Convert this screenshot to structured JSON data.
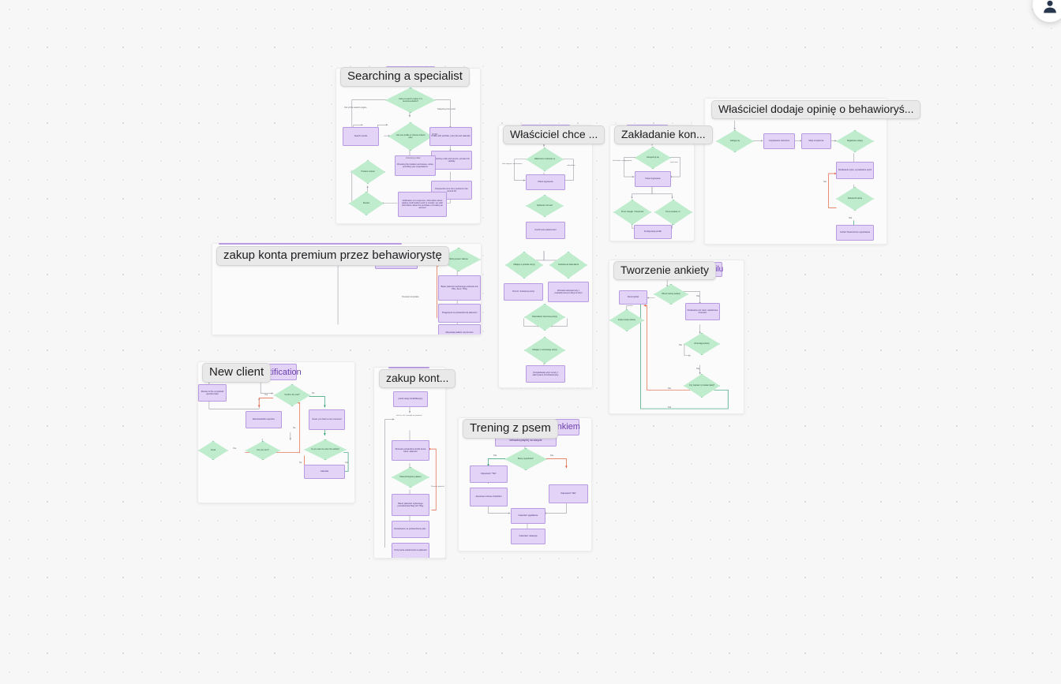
{
  "app": {
    "canvas_background": "#f7f7f8",
    "node_fill_purple": "#e3d4f7",
    "node_stroke_purple": "#b79ae0",
    "node_fill_green": "#bfeccd",
    "node_stroke_green": "#79c894",
    "edge_yes_color": "#2f9e6e",
    "edge_no_color": "#e0603f",
    "edge_default_color": "#9a9aa4"
  },
  "toolbar": {
    "avatar_icon": "user-avatar-icon"
  },
  "frames": [
    {
      "id": "searching-a-specialist",
      "title": "Searching a specialist",
      "banner_label": "",
      "nodes": [
        {
          "type": "diamond",
          "text": "Using a search engine or a recommendation?"
        },
        {
          "type": "rect",
          "text": "Search results"
        },
        {
          "type": "diamond",
          "text": "Just one profile or choose criteria plan"
        },
        {
          "type": "rect",
          "text": "Profile with portfolio, price list and calendar"
        },
        {
          "type": "rect",
          "text": "Selecting a title and service, private rich visibility"
        },
        {
          "type": "rect",
          "text": "Choosing the location and issues, notes, providing your expectations"
        },
        {
          "type": "rect",
          "text": "Perspective time form pushed to the remind list"
        },
        {
          "type": "rect",
          "text": "Notification of a response, information about waiting confirmation push or contact, we wish information about the purchase of creating an account"
        },
        {
          "type": "diamond",
          "text": "Product contact"
        },
        {
          "type": "diamond",
          "text": "Review"
        }
      ],
      "edge_labels": [
        "Out of the search engine",
        "Selecting from a list",
        "Profile",
        "choosing a date"
      ]
    },
    {
      "id": "zakup-konta-premium",
      "title": "zakup konta premium przez behawiorystę",
      "banner_label": "",
      "nodes": [
        {
          "type": "rect",
          "text": "Zimna i potwierdzeni linkiej konta baza i płatność"
        },
        {
          "type": "diamond",
          "text": "Mózg system zakupu"
        },
        {
          "type": "rect",
          "text": "Baner płatności wybranego podmiotu lub PSU, ALG i TPay"
        },
        {
          "type": "rect",
          "text": "Ściągnięcia na potwierdzenia płatności"
        },
        {
          "type": "rect",
          "text": "Aktywacja pakietu na premium"
        }
      ],
      "edge_labels": [
        "Ponowić wszystkie"
      ]
    },
    {
      "id": "wlasciciel-chce",
      "title": "Właściciel chce ...",
      "banner_label": "",
      "nodes": [
        {
          "type": "diamond",
          "text": "Właściciel w ankiecie są"
        },
        {
          "type": "rect",
          "text": "Płatni logowania"
        },
        {
          "type": "diamond",
          "text": "Wybieram formach"
        },
        {
          "type": "rect",
          "text": "Konfirmowi wiadomości"
        },
        {
          "type": "diamond",
          "text": "Klikając w portalie wizyty"
        },
        {
          "type": "diamond",
          "text": "Gotówka do kalendarza"
        },
        {
          "type": "rect",
          "text": "Termin i funkcjonuj wizyt"
        },
        {
          "type": "rect",
          "text": "Wniosek tekstowe listy z powiadomionymi danymi wizyt"
        },
        {
          "type": "diamond",
          "text": "Odwrotkami tworzonej wizyty"
        },
        {
          "type": "diamond",
          "text": "Klikając w rezerwację wizyty"
        },
        {
          "type": "rect",
          "text": "Oczujki/kwały wizyt w listy z zakrzywami od behawiorysty"
        }
      ],
      "edge_labels": [
        "Jako ukrywa i zachowanie",
        "nakrytkiem"
      ]
    },
    {
      "id": "zakladanie-konta",
      "title": "Zakładanie kon...",
      "banner_label": "",
      "nodes": [
        {
          "type": "diamond",
          "text": "Zarejestruj się"
        },
        {
          "type": "rect",
          "text": "Panel logowania"
        },
        {
          "type": "diamond",
          "text": "Przez Google / Facebook"
        },
        {
          "type": "diamond",
          "text": "Przez podanie nr..."
        },
        {
          "type": "rect",
          "text": "Konfiguracja profilu"
        }
      ],
      "edge_labels": [
        "Jeśli konta i zalogowanie",
        "zwrócenie"
      ]
    },
    {
      "id": "wlasciciel-dodaje-opinie",
      "title": "Właściciel dodaje opinię o behawioryś...",
      "banner_label": "",
      "nodes": [
        {
          "type": "diamond",
          "text": "Zaloguj się"
        },
        {
          "type": "rect",
          "text": "Uzyskiwanie ostrzeżeń"
        },
        {
          "type": "rect",
          "text": "Moje urządzenie"
        },
        {
          "type": "diamond",
          "text": "Wyjątkowe wstępy"
        },
        {
          "type": "rect",
          "text": "Dodawanie opisu, wystawianie opinii"
        },
        {
          "type": "diamond",
          "text": "Zatwierdź opinię"
        },
        {
          "type": "rect",
          "text": "Gdzie? Dostrzeżone wypełniania"
        }
      ],
      "edge_labels": [
        "Nie",
        "Tak"
      ]
    },
    {
      "id": "tworzenie-ankiety",
      "title": "Tworzenie ankiety",
      "banner_label": "i profilu",
      "nodes": [
        {
          "type": "rect",
          "text": "Panel ankiet"
        },
        {
          "type": "diamond",
          "text": "Określ nazwę ankiety"
        },
        {
          "type": "diamond",
          "text": "Edytuj swoje ankiety"
        },
        {
          "type": "rect",
          "text": "Dodawanie pól: tekst, wielokrotne krotności"
        },
        {
          "type": "diamond",
          "text": "Zmieniają ankiety"
        },
        {
          "type": "diamond",
          "text": "Czy zapisać i przesłać dalej?"
        }
      ],
      "edge_labels": [
        "Tak",
        "Nie",
        "Tak",
        "Nie",
        "Tak"
      ]
    },
    {
      "id": "new-client",
      "title": "New client",
      "banner_label": "a notification",
      "nodes": [
        {
          "type": "rect",
          "text": "New client"
        },
        {
          "type": "rect",
          "text": "Review of the completed questionnaire"
        },
        {
          "type": "diamond",
          "text": "Confirm the visit?"
        },
        {
          "type": "rect",
          "text": "Reschedule/Do rejection"
        },
        {
          "type": "rect",
          "text": "Great, you have a new customer"
        },
        {
          "type": "diamond",
          "text": "Are you sure?"
        },
        {
          "type": "diamond",
          "text": "Do you want to enter the activity?"
        },
        {
          "type": "diamond",
          "text": "Great"
        },
        {
          "type": "rect",
          "text": "Calendar"
        }
      ],
      "edge_labels": [
        "Yes",
        "No",
        "No",
        "Yes",
        "No",
        "Yes",
        "Yes"
      ]
    },
    {
      "id": "zakup-kont",
      "title": "zakup kont...",
      "banner_label": "",
      "nodes": [
        {
          "type": "diamond",
          "text": "Logowanie"
        },
        {
          "type": "rect",
          "text": "panel usługi rehabilitacyjny"
        },
        {
          "type": "rect",
          "text": "Wniosek potwierdzeń krótki konta baza i płatność"
        },
        {
          "type": "diamond",
          "text": "Płatność/wyboru pakietu"
        },
        {
          "type": "rect",
          "text": "Baner płatności wybranego pośrednictwa Płaty lub TPay"
        },
        {
          "type": "rect",
          "text": "Oczekiwanie na potwierdzenie płat..."
        },
        {
          "type": "rect",
          "text": "Otrzymanie wiadomości na płatność"
        }
      ],
      "edge_labels": [
        "Jeśli on i Es \"przejdź na premium\"",
        "Ponowić płatność"
      ]
    },
    {
      "id": "trening-z-psem",
      "title": "Trening z psem",
      "banner_label": "ący z linkiem",
      "nodes": [
        {
          "type": "rect",
          "text": "Zdjęcie dotkowo i trening ogólnej przez behawiorystę/tej na wizycie"
        },
        {
          "type": "diamond",
          "text": "Barwy wypełniam?"
        },
        {
          "type": "rect",
          "text": "Odpowiedz \"TAK\""
        },
        {
          "type": "rect",
          "text": "Odpowiedz \"NIE\""
        },
        {
          "type": "rect",
          "text": "Zamówień zdrowe OCENIAJ"
        },
        {
          "type": "rect",
          "text": "Kalendarz jagódkowe"
        },
        {
          "type": "rect",
          "text": "Kalendarz rekapcija"
        }
      ],
      "edge_labels": [
        "Tak",
        "Nie"
      ]
    }
  ]
}
